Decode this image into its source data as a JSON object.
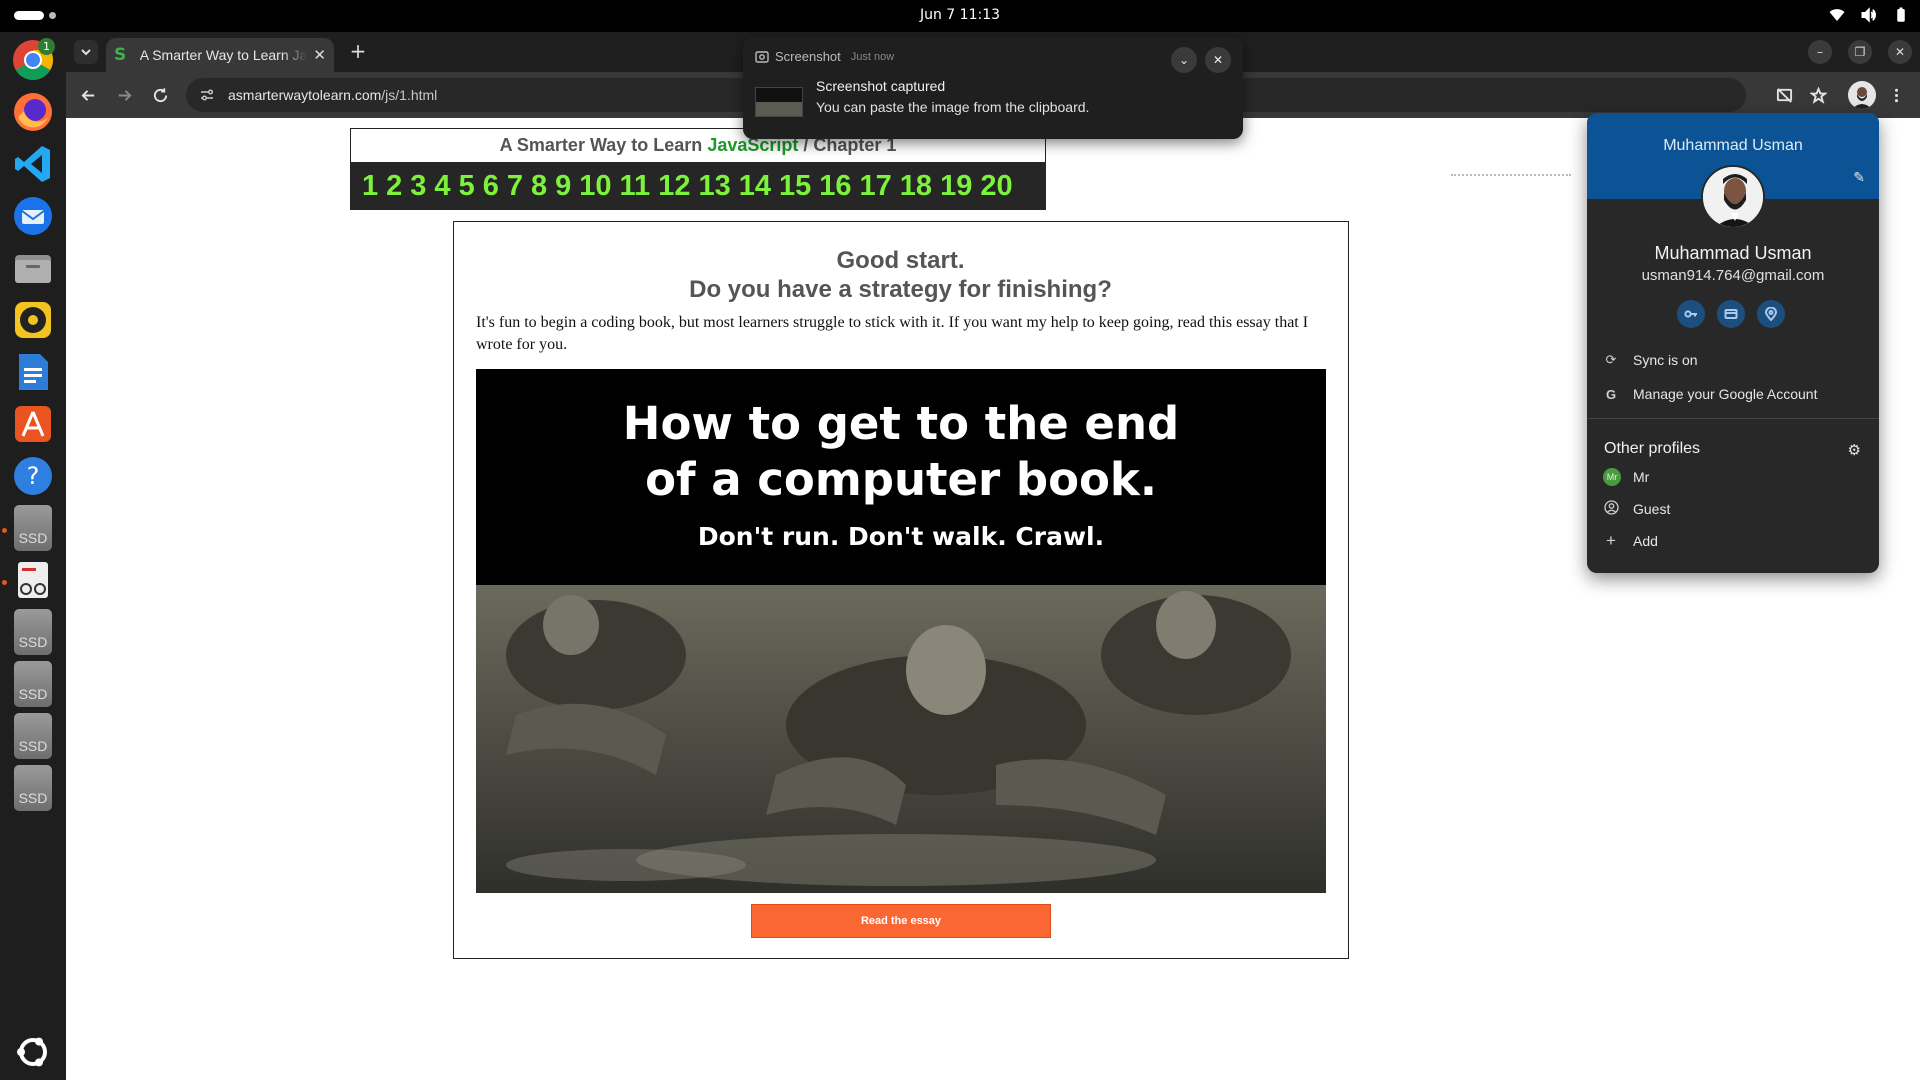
{
  "system": {
    "clock": "Jun 7  11:13",
    "dock_badge": "1",
    "ssd_label": "SSD"
  },
  "browser": {
    "tab_title": "A Smarter Way to Learn JavaScript",
    "tab_favicon": "S",
    "url_host": "asmarterwaytolearn.com",
    "url_path": "/js/1.html"
  },
  "page": {
    "book_title_pre": "A Smarter Way to Learn ",
    "book_title_js": "JavaScript",
    "book_title_post": "  /  Chapter 1",
    "chapters": [
      "1",
      "2",
      "3",
      "4",
      "5",
      "6",
      "7",
      "8",
      "9",
      "10",
      "11",
      "12",
      "13",
      "14",
      "15",
      "16",
      "17",
      "18",
      "19",
      "20"
    ],
    "heading1": "Good start.",
    "heading2": "Do you have a strategy for finishing?",
    "paragraph": "It's fun to begin a coding book, but most learners struggle to stick with it. If you want my help to keep going, read this essay that I wrote for you.",
    "hero_line1": "How to get to the end",
    "hero_line2": "of a computer book.",
    "hero_sub": "Don't run. Don't walk. Crawl.",
    "read_button": "Read the essay"
  },
  "notification": {
    "app": "Screenshot",
    "time": "Just now",
    "title": "Screenshot captured",
    "body": "You can paste the image from the clipboard."
  },
  "profile": {
    "banner_name": "Muhammad Usman",
    "name": "Muhammad Usman",
    "email": "usman914.764@gmail.com",
    "sync": "Sync is on",
    "manage": "Manage your Google Account",
    "other_title": "Other profiles",
    "other": [
      {
        "label": "Mr",
        "badge": "Mr"
      },
      {
        "label": "Guest"
      },
      {
        "label": "Add"
      }
    ]
  },
  "colors": {
    "accent_green": "#7cf23b",
    "button_orange": "#fa6733",
    "profile_blue": "#0b5394"
  }
}
